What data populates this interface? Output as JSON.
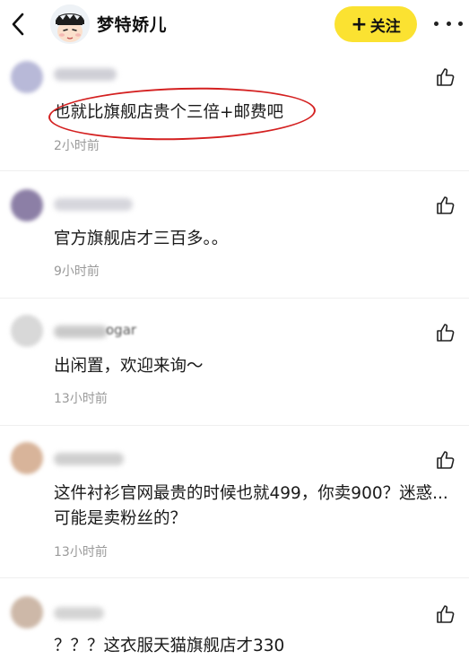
{
  "header": {
    "username": "梦特娇儿",
    "follow_label": "关注",
    "follow_plus": "+"
  },
  "comments": [
    {
      "text": "也就比旗舰店贵个三倍+邮费吧",
      "time": "2小时前",
      "avatar_color": "#b8b9d8",
      "name_color": "#cfcfd6"
    },
    {
      "text": "官方旗舰店才三百多。。",
      "time": "9小时前",
      "avatar_color": "#8c7fa6",
      "name_color": "#d6d6dc"
    },
    {
      "text": "出闲置，欢迎来询～",
      "time": "13小时前",
      "avatar_color": "#d8d8d8",
      "name_color": "#c9c9c9",
      "name_fragment": "ogar"
    },
    {
      "text": "这件衬衫官网最贵的时候也就499，你卖900？迷惑...可能是卖粉丝的？",
      "time": "13小时前",
      "avatar_color": "#d8b49a",
      "name_color": "#cfcfcf"
    },
    {
      "text": "？？？这衣服天猫旗舰店才330",
      "time": "",
      "avatar_color": "#cdb8a8",
      "name_color": "#d4d4d4"
    }
  ],
  "icons": {
    "back": "chevron-left-icon",
    "more": "more-dots-icon",
    "like": "thumbs-up-icon"
  },
  "colors": {
    "follow_bg": "#fbe231",
    "annotation": "#d42020",
    "time_text": "#9a9a9a"
  }
}
